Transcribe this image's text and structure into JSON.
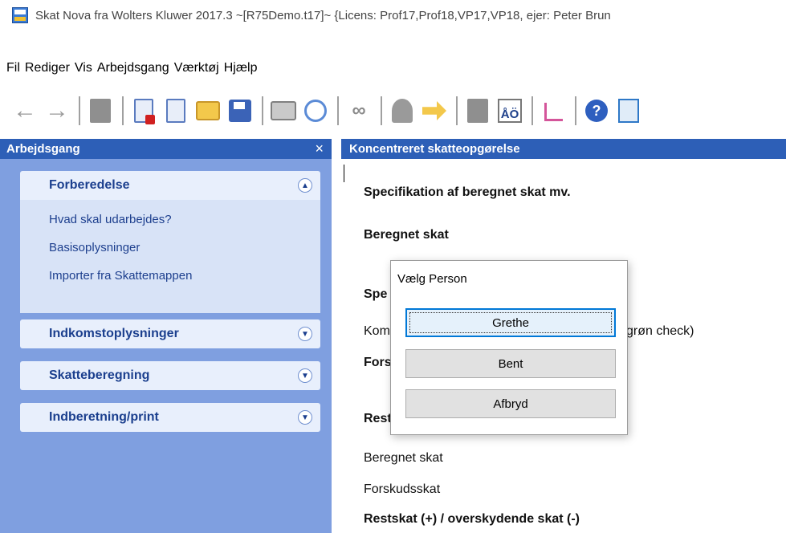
{
  "window": {
    "title": "Skat Nova fra Wolters Kluwer 2017.3  ~[R75Demo.t17]~  {Licens: Prof17,Prof18,VP17,VP18, ejer: Peter Brun"
  },
  "menu": [
    "Fil",
    "Rediger",
    "Vis",
    "Arbejdsgang",
    "Værktøj",
    "Hjælp"
  ],
  "toolbar": {
    "icons": [
      "back-arrow-icon",
      "forward-arrow-icon",
      "book-icon",
      "new-document-icon",
      "delete-document-icon",
      "open-folder-icon",
      "save-icon",
      "print-icon",
      "print-preview-icon",
      "link-icon",
      "person-icon",
      "import-arrow-icon",
      "document-gray-icon",
      "spell-check-icon",
      "check-icon",
      "help-icon",
      "add-document-icon"
    ]
  },
  "left_pane": {
    "title": "Arbejdsgang",
    "close_glyph": "×",
    "sections": [
      {
        "label": "Forberedelse",
        "expanded": true,
        "items": [
          "Hvad skal udarbejdes?",
          "Basisoplysninger",
          "Importer fra Skattemappen"
        ]
      },
      {
        "label": "Indkomstoplysninger",
        "expanded": false
      },
      {
        "label": "Skatteberegning",
        "expanded": false
      },
      {
        "label": "Indberetning/print",
        "expanded": false
      }
    ],
    "chevron_up": "⌃",
    "chevron_down": "⌄"
  },
  "right_pane": {
    "title": "Koncentreret skatteopgørelse",
    "lines": [
      {
        "text": "Specifikation af beregnet skat mv.",
        "bold": true
      },
      {
        "text": "Beregnet skat",
        "bold": true
      },
      {
        "text": "Spe",
        "bold": true
      },
      {
        "text": "Kom",
        "bold": false
      },
      {
        "text": "grøn check)",
        "bold": false
      },
      {
        "text": "Fors",
        "bold": true
      },
      {
        "text": "Rest",
        "bold": true
      },
      {
        "text": "Beregnet skat",
        "bold": false
      },
      {
        "text": "Forskudsskat",
        "bold": false
      },
      {
        "text": "Restskat (+) / overskydende skat (-)",
        "bold": true
      }
    ]
  },
  "dialog": {
    "title": "Vælg Person",
    "buttons": [
      "Grethe",
      "Bent",
      "Afbryd"
    ]
  }
}
